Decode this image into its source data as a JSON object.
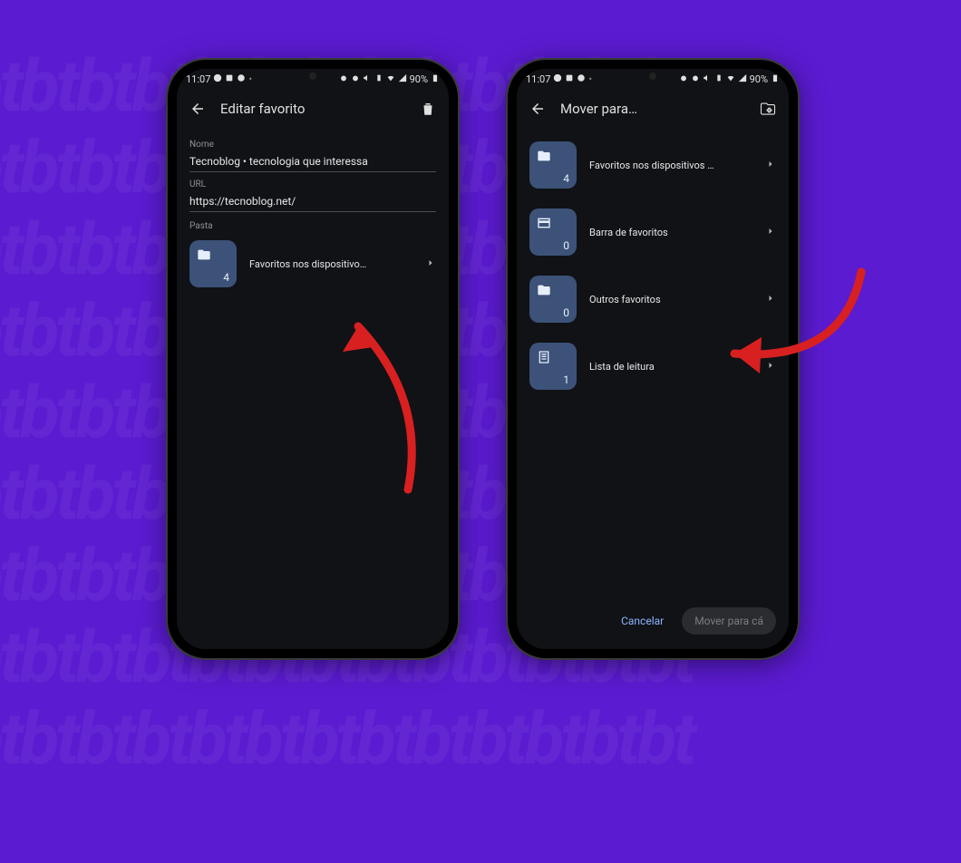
{
  "status": {
    "time": "11:07",
    "battery": "90%",
    "left_icons": [
      "whatsapp-icon",
      "image-icon",
      "wave-icon",
      "dot-icon"
    ],
    "right_icons": [
      "alarm-icon",
      "alarm-icon",
      "mute-icon",
      "vibrate-icon",
      "wifi-icon",
      "signal-icon"
    ]
  },
  "screen1": {
    "appbar_title": "Editar favorito",
    "name_label": "Nome",
    "name_value": "Tecnoblog • tecnologia que interessa",
    "url_label": "URL",
    "url_value": "https://tecnoblog.net/",
    "folder_label": "Pasta",
    "folder": {
      "label": "Favoritos nos dispositivo…",
      "count": 4,
      "icon": "folder-icon"
    }
  },
  "screen2": {
    "appbar_title": "Mover para…",
    "folders": [
      {
        "label": "Favoritos nos dispositivos …",
        "count": 4,
        "icon": "folder-icon"
      },
      {
        "label": "Barra de favoritos",
        "count": 0,
        "icon": "bookmark-bar-icon"
      },
      {
        "label": "Outros favoritos",
        "count": 0,
        "icon": "folder-icon"
      },
      {
        "label": "Lista de leitura",
        "count": 1,
        "icon": "reading-list-icon"
      }
    ],
    "cancel": "Cancelar",
    "move": "Mover para cá"
  }
}
